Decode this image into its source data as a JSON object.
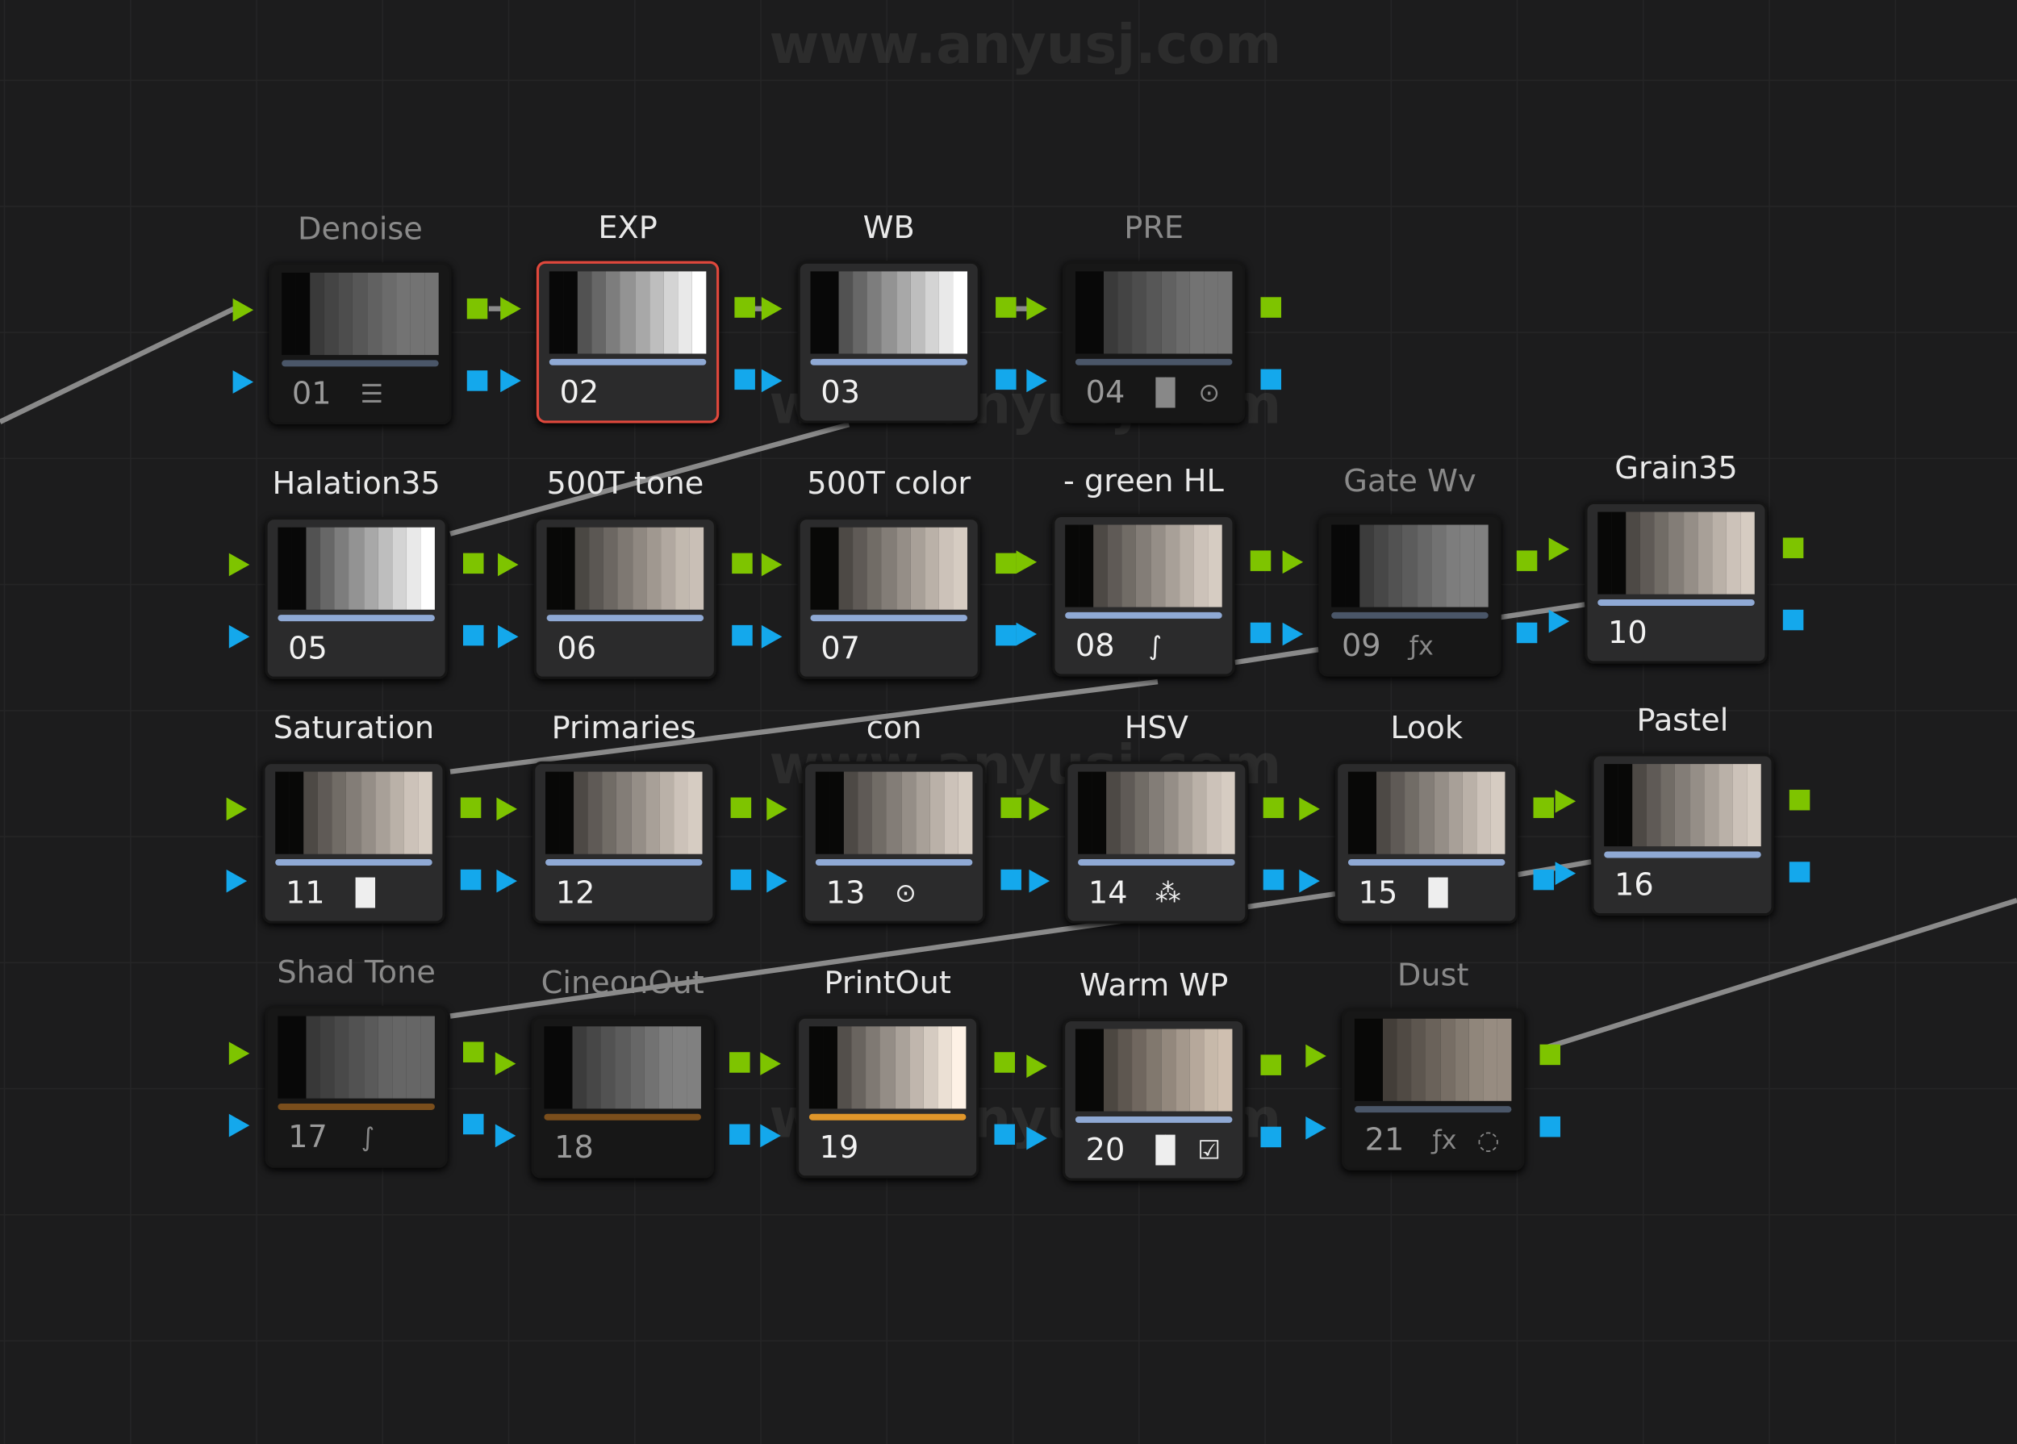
{
  "watermark": "www.anyusj.com",
  "colors": {
    "rgb_port": "#7ec400",
    "alpha_port": "#14a8ec",
    "selected_border": "#e0483c",
    "bar": "#8fa9d4",
    "cache_bar": "#e0962a"
  },
  "nodes": [
    {
      "label": "Denoise",
      "number": "01",
      "disabled": true,
      "icons": [
        "noise-reduction-icon"
      ]
    },
    {
      "label": "EXP",
      "number": "02",
      "selected": true,
      "icons": []
    },
    {
      "label": "WB",
      "number": "03",
      "icons": []
    },
    {
      "label": "PRE",
      "number": "04",
      "disabled": true,
      "icons": [
        "bars-icon",
        "circle-dot-icon"
      ]
    },
    {
      "label": "Halation35",
      "number": "05",
      "icons": []
    },
    {
      "label": "500T tone",
      "number": "06",
      "icons": []
    },
    {
      "label": "500T color",
      "number": "07",
      "icons": []
    },
    {
      "label": "- green HL",
      "number": "08",
      "icons": [
        "curve-icon"
      ]
    },
    {
      "label": "Gate Wv",
      "number": "09",
      "disabled": true,
      "icons": [
        "fx-icon"
      ]
    },
    {
      "label": "Grain35",
      "number": "10",
      "icons": []
    },
    {
      "label": "Saturation",
      "number": "11",
      "icons": [
        "bars-icon"
      ]
    },
    {
      "label": "Primaries",
      "number": "12",
      "icons": []
    },
    {
      "label": "con",
      "number": "13",
      "icons": [
        "circle-dot-icon"
      ]
    },
    {
      "label": "HSV",
      "number": "14",
      "icons": [
        "hsv-dots-icon"
      ]
    },
    {
      "label": "Look",
      "number": "15",
      "icons": [
        "bars-icon"
      ]
    },
    {
      "label": "Pastel",
      "number": "16",
      "icons": []
    },
    {
      "label": "Shad Tone",
      "number": "17",
      "disabled": true,
      "cached": true,
      "icons": [
        "curve-icon"
      ]
    },
    {
      "label": "CineonOut",
      "number": "18",
      "disabled": true,
      "cached": true,
      "icons": []
    },
    {
      "label": "PrintOut",
      "number": "19",
      "cached": true,
      "icons": []
    },
    {
      "label": "Warm WP",
      "number": "20",
      "icons": [
        "bars-icon",
        "checkbox-icon"
      ]
    },
    {
      "label": "Dust",
      "number": "21",
      "disabled": true,
      "icons": [
        "fx-icon",
        "dashed-circle-icon"
      ]
    }
  ]
}
